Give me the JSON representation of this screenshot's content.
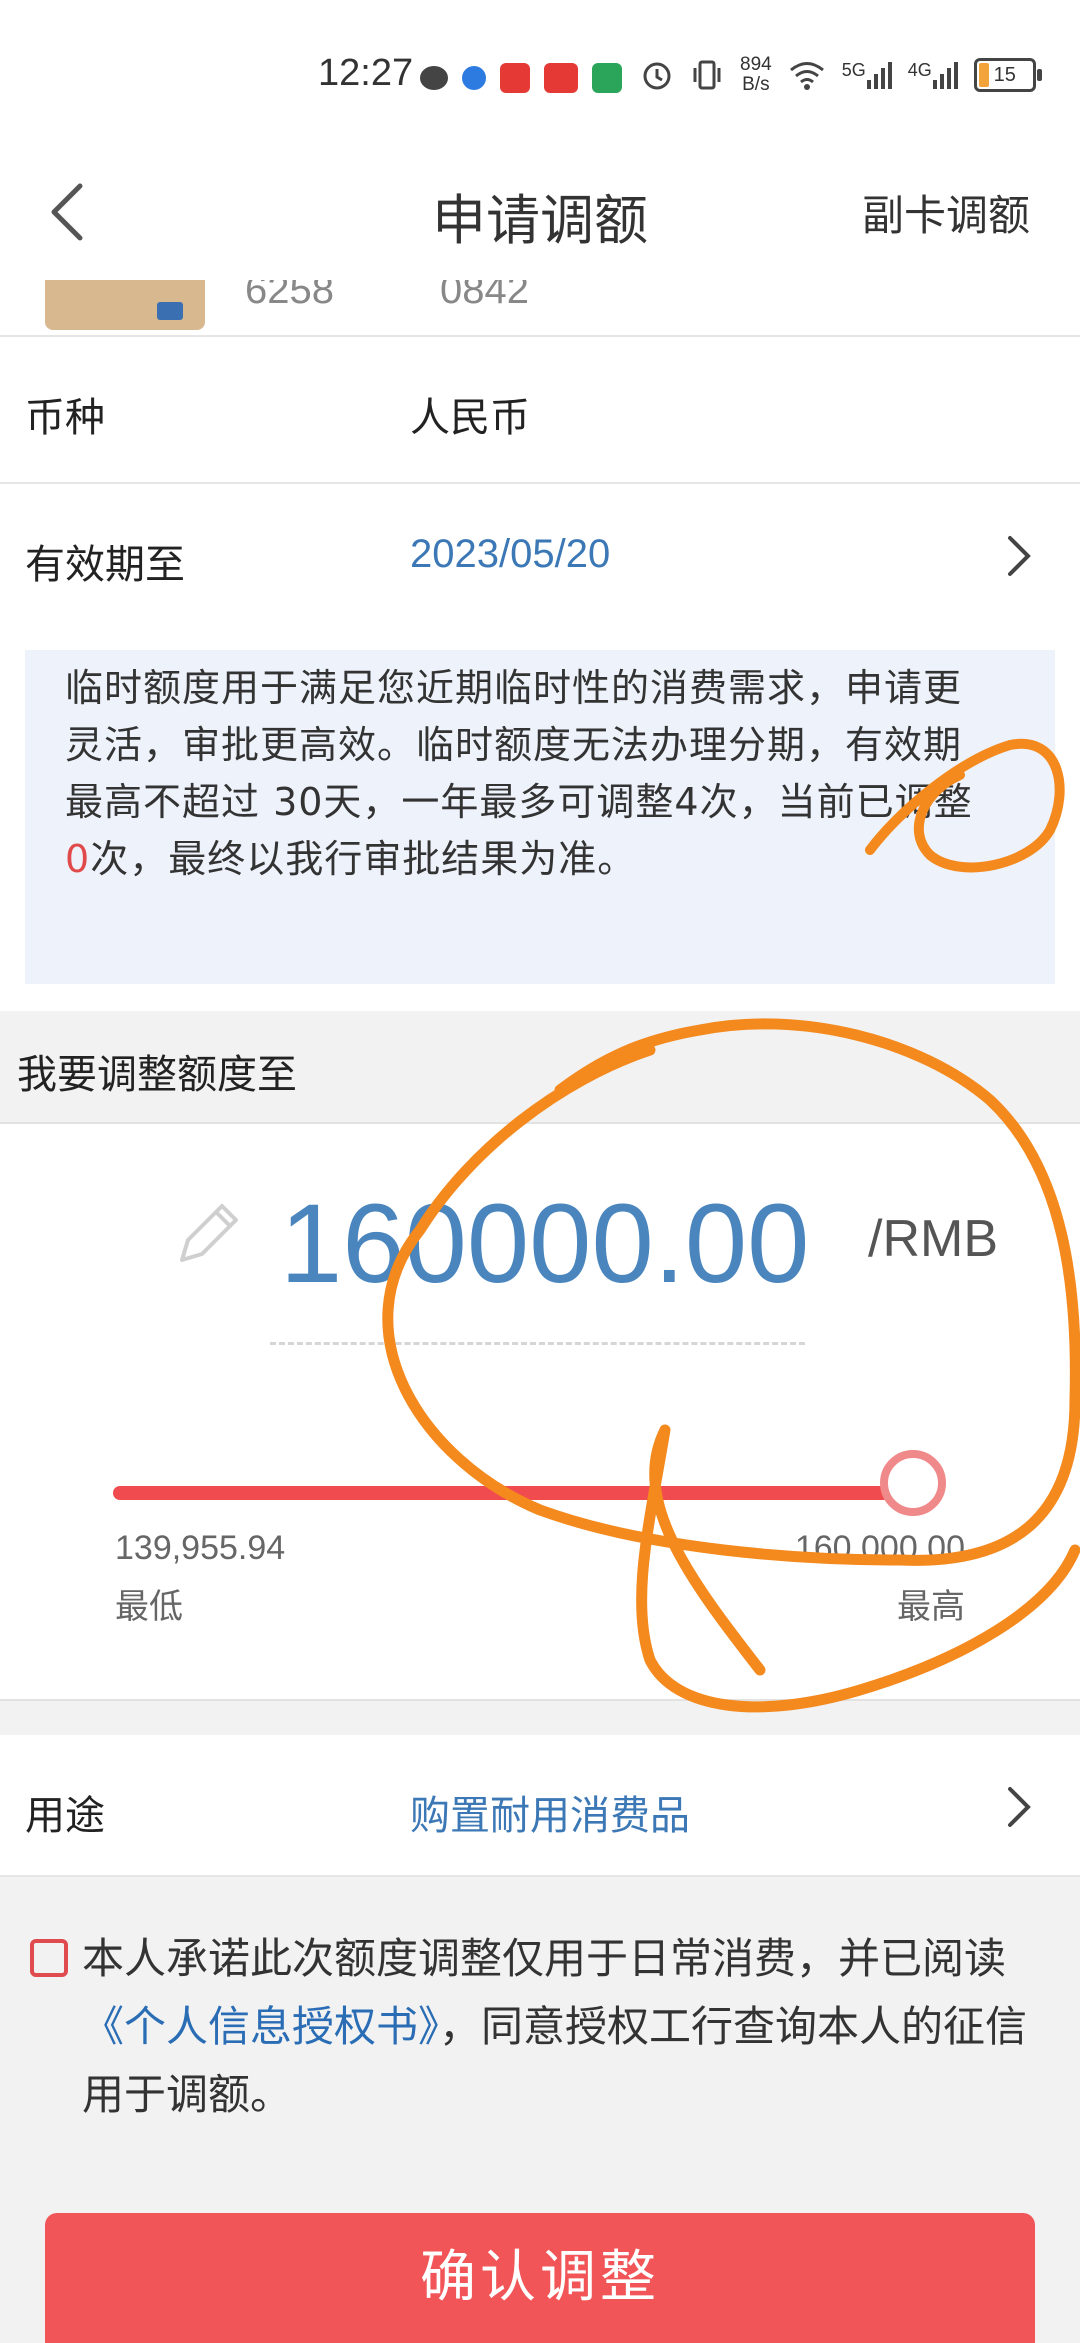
{
  "status_bar": {
    "time": "12:27",
    "net_speed_value": "894",
    "net_speed_unit": "B/s",
    "signal_1": "5G",
    "signal_2": "4G",
    "battery": "15",
    "icons": [
      "wechat-icon",
      "browser-icon",
      "notes-icon",
      "shopping-icon",
      "video-icon",
      "alarm-icon",
      "vibrate-icon",
      "wifi-icon",
      "signal-icon",
      "signal-icon",
      "battery-icon"
    ]
  },
  "nav": {
    "title": "申请调额",
    "right_action": "副卡调额"
  },
  "card": {
    "number_left": "6258",
    "number_right": "0842"
  },
  "currency": {
    "label": "币种",
    "value": "人民币"
  },
  "validity": {
    "label": "有效期至",
    "value": "2023/05/20"
  },
  "notice": {
    "text_before": "临时额度用于满足您近期临时性的消费需求，申请更灵活，审批更高效。临时额度无法办理分期，有效期最高不超过 30天，一年最多可调整4次，当前已调整 ",
    "count": "0",
    "text_after": "次，最终以我行审批结果为准。"
  },
  "adjust": {
    "heading": "我要调整额度至",
    "amount": "160000.00",
    "unit": "/RMB",
    "min_value": "139,955.94",
    "min_label": "最低",
    "max_value": "160,000.00",
    "max_label": "最高",
    "slider_fraction": 1.0
  },
  "purpose": {
    "label": "用途",
    "value": "购置耐用消费品"
  },
  "agreement": {
    "text_1": "本人承诺此次额度调整仅用于日常消费，并已阅读",
    "link": "《个人信息授权书》",
    "text_2": "，同意授权工行查询本人的征信用于调额。",
    "checked": false
  },
  "confirm_button": "确认调整",
  "colors": {
    "accent_blue": "#4a86bd",
    "accent_red": "#f25557",
    "annotation_orange": "#f4891e"
  }
}
